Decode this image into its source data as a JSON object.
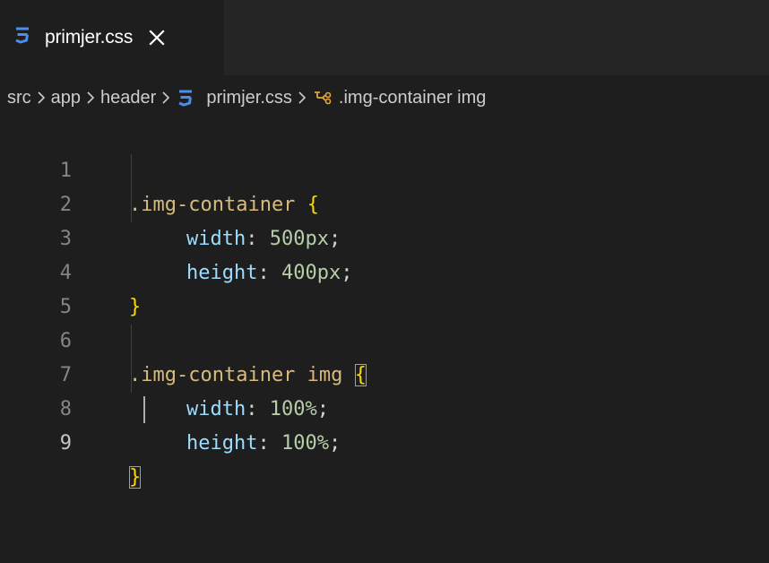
{
  "tab": {
    "label": "primjer.css",
    "close_glyph": "✕",
    "icon": "css3-icon"
  },
  "breadcrumb": {
    "items": [
      "src",
      "app",
      "header",
      "primjer.css",
      ".img-container img"
    ],
    "separator_icon": "chevron-right-icon",
    "symbol_icon": "css-rule-symbol-icon"
  },
  "editor": {
    "lines": [
      {
        "num": "1",
        "parts": {
          "sel": ".img-container",
          "sp": " ",
          "brace": "{"
        }
      },
      {
        "num": "2",
        "parts": {
          "prop": "width",
          "colon": ":",
          "sp": " ",
          "val": "500px",
          "semi": ";"
        }
      },
      {
        "num": "3",
        "parts": {
          "prop": "height",
          "colon": ":",
          "sp": " ",
          "val": "400px",
          "semi": ";"
        }
      },
      {
        "num": "4",
        "parts": {
          "brace": "}"
        }
      },
      {
        "num": "5"
      },
      {
        "num": "6",
        "parts": {
          "sel": ".img-container img",
          "sp": " ",
          "brace": "{"
        }
      },
      {
        "num": "7",
        "parts": {
          "prop": "width",
          "colon": ":",
          "sp": " ",
          "val": "100%",
          "semi": ";"
        }
      },
      {
        "num": "8",
        "parts": {
          "prop": "height",
          "colon": ":",
          "sp": " ",
          "val": "100%",
          "semi": ";"
        }
      },
      {
        "num": "9",
        "parts": {
          "brace": "}"
        }
      }
    ],
    "active_line": "9"
  },
  "colors": {
    "background": "#1e1e1e",
    "selector": "#d7ba7d",
    "brace": "#ffd700",
    "property": "#9cdcfe",
    "number": "#b5cea8",
    "css_icon": "#3a7bd5"
  }
}
